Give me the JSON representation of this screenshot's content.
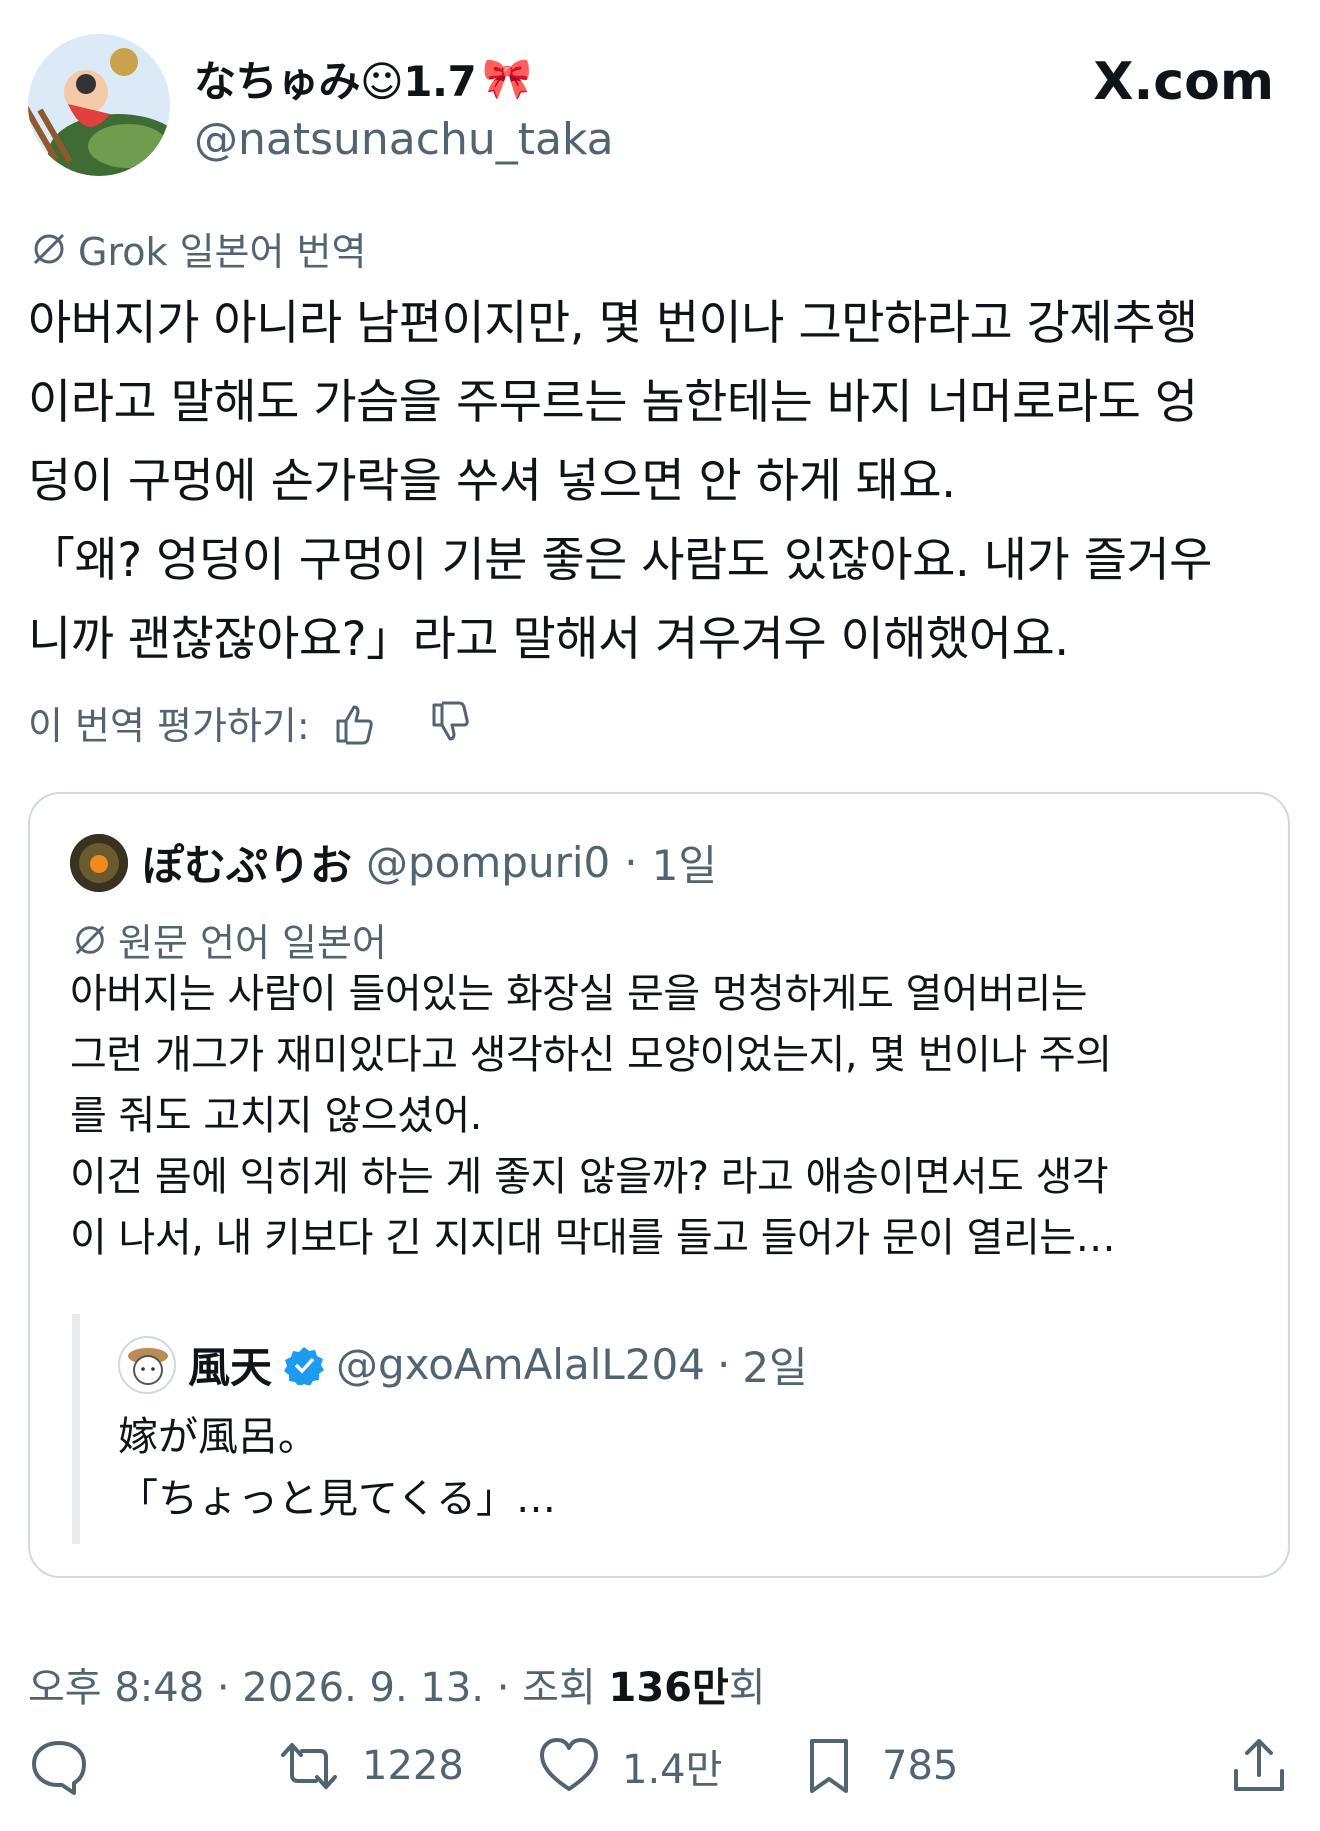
{
  "author": {
    "display_name": "なちゅみ☺1.7",
    "display_emoji": "🎀",
    "handle": "@natsunachu_taka"
  },
  "brand": {
    "site": "X.com"
  },
  "translation": {
    "label": "Grok 일본어 번역",
    "text": "아버지가 아니라 남편이지만, 몇 번이나 그만하라고 강제추행\n이라고 말해도 가슴을 주무르는 놈한테는 바지 너머로라도 엉\n덩이 구멍에 손가락을 쑤셔 넣으면 안 하게 돼요.\n「왜? 엉덩이 구멍이 기분 좋은 사람도 있잖아요. 내가 즐거우\n니까 괜찮잖아요?」라고 말해서 겨우겨우 이해했어요.",
    "rate_label": "이 번역 평가하기:"
  },
  "quote": {
    "name": "ぽむぷりお",
    "handle": "@pompuri0",
    "time": "1일",
    "lang_label": "원문 언어 일본어",
    "text": "아버지는 사람이 들어있는 화장실 문을 멍청하게도 열어버리는\n그런 개그가 재미있다고 생각하신 모양이었는지, 몇 번이나 주의\n를 줘도 고치지 않으셨어.\n이건 몸에 익히게 하는 게 좋지 않을까? 라고 애송이면서도 생각\n이 나서, 내 키보다 긴 지지대 막대를 들고 들어가 문이 열리는…",
    "nested": {
      "name": "風天",
      "handle": "@gxoAmAlalL204",
      "time": "2일",
      "text": "嫁が風呂。\n「ちょっと見てくる」…"
    }
  },
  "meta": {
    "time": "오후 8:48",
    "date": "2026. 9. 13.",
    "views_prefix": "조회",
    "views_count": "136만",
    "views_suffix": "회"
  },
  "actions": {
    "replies": "",
    "retweets": "1228",
    "likes": "1.4만",
    "bookmarks": "785"
  },
  "colors": {
    "text": "#0f1419",
    "muted": "#536471",
    "border": "#cfd9de",
    "verified": "#1d9bf0"
  }
}
